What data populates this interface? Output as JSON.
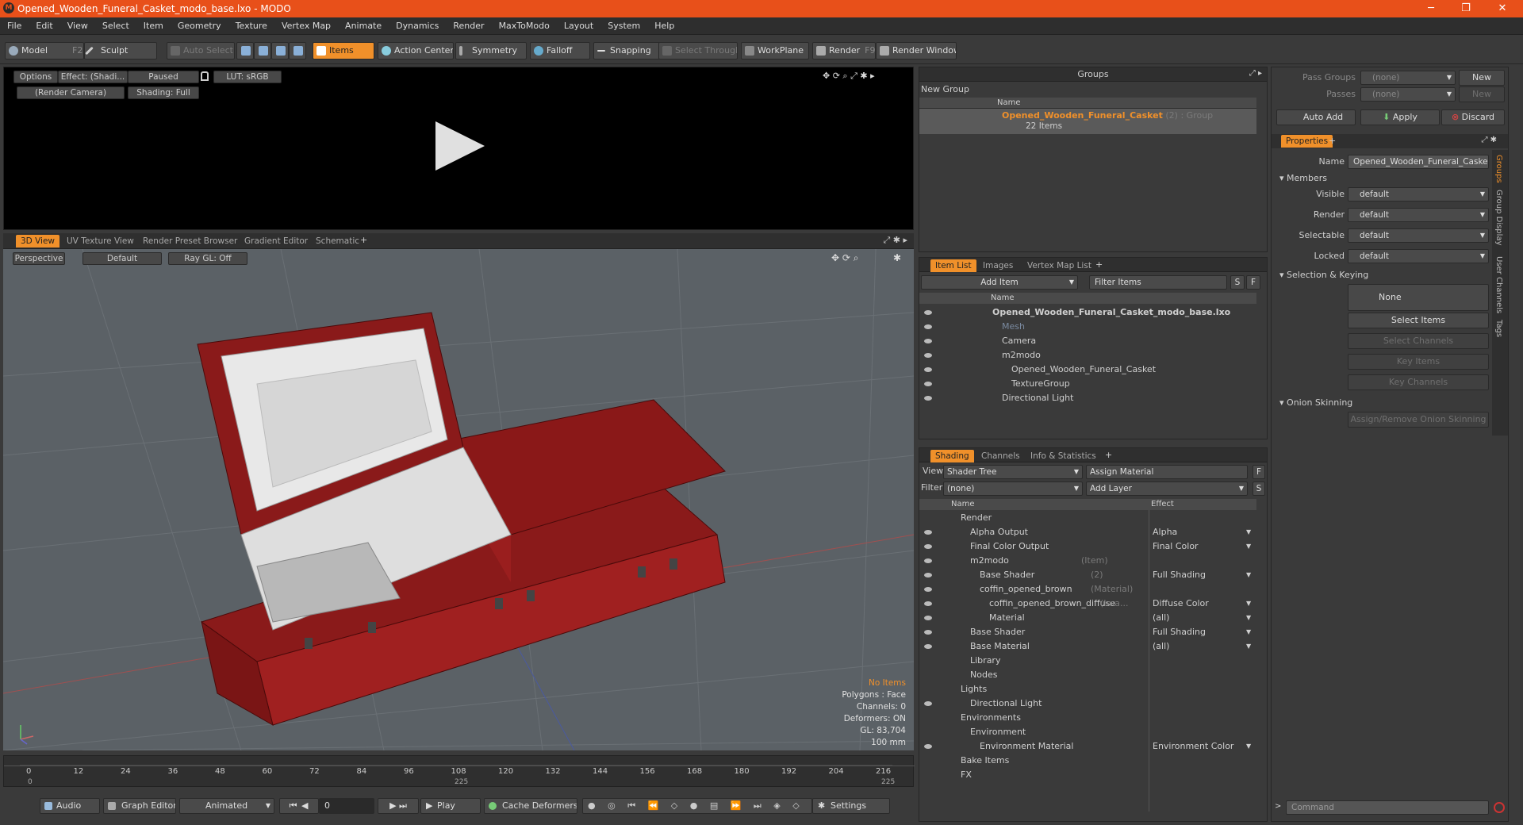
{
  "window": {
    "title": "Opened_Wooden_Funeral_Casket_modo_base.lxo - MODO",
    "logo": "modo-logo-icon",
    "accent": "#e8501a"
  },
  "menu": [
    "File",
    "Edit",
    "View",
    "Select",
    "Item",
    "Geometry",
    "Texture",
    "Vertex Map",
    "Animate",
    "Dynamics",
    "Render",
    "MaxToModo",
    "Layout",
    "System",
    "Help"
  ],
  "toolbar": {
    "model": "Model",
    "model_key": "F2",
    "sculpt": "Sculpt",
    "auto_select": "Auto Select",
    "items": "Items",
    "action_center": "Action Center",
    "symmetry": "Symmetry",
    "falloff": "Falloff",
    "snapping": "Snapping",
    "select_through": "Select Through",
    "workplane": "WorkPlane",
    "render": "Render",
    "render_key": "F9",
    "render_window": "Render Window"
  },
  "preview": {
    "options": "Options",
    "effect": "Effect: (Shadi...",
    "paused": "Paused",
    "lut": "LUT: sRGB",
    "camera": "(Render Camera)",
    "shading": "Shading: Full"
  },
  "viewport_tabs": [
    "3D View",
    "UV Texture View",
    "Render Preset Browser",
    "Gradient Editor",
    "Schematic"
  ],
  "viewport": {
    "perspective": "Perspective",
    "default": "Default",
    "raygl": "Ray GL: Off",
    "stats": {
      "no_items": "No Items",
      "polygons": "Polygons : Face",
      "channels": "Channels: 0",
      "deformers": "Deformers: ON",
      "gl": "GL: 83,704",
      "size": "100 mm"
    }
  },
  "timeline": {
    "ticks": [
      "0",
      "12",
      "24",
      "36",
      "48",
      "60",
      "72",
      "84",
      "96",
      "108",
      "120",
      "132",
      "144",
      "156",
      "168",
      "180",
      "192",
      "204",
      "216"
    ],
    "sub_left": "0",
    "sub_mid": "225",
    "sub_right": "225"
  },
  "bottombar": {
    "audio": "Audio",
    "graph_editor": "Graph Editor",
    "animated": "Animated",
    "frame": "0",
    "play": "Play",
    "cache": "Cache Deformers",
    "settings": "Settings"
  },
  "groups": {
    "title": "Groups",
    "new_group": "New Group",
    "col_name": "Name",
    "item_name": "Opened_Wooden_Funeral_Casket",
    "item_count": "(2)",
    "item_type": ": Group",
    "item_sub": "22 Items"
  },
  "itemlist": {
    "tabs": [
      "Item List",
      "Images",
      "Vertex Map List"
    ],
    "add_item": "Add Item",
    "filter": "Filter Items",
    "s": "S",
    "f": "F",
    "col_name": "Name",
    "rows": [
      {
        "label": "Opened_Wooden_Funeral_Casket_modo_base.lxo",
        "indent": 0,
        "bold": true
      },
      {
        "label": "Mesh",
        "indent": 1,
        "dim": true
      },
      {
        "label": "Camera",
        "indent": 1
      },
      {
        "label": "m2modo",
        "indent": 1
      },
      {
        "label": "Opened_Wooden_Funeral_Casket",
        "indent": 2
      },
      {
        "label": "TextureGroup",
        "indent": 2
      },
      {
        "label": "Directional Light",
        "indent": 1
      }
    ]
  },
  "shading": {
    "tabs": [
      "Shading",
      "Channels",
      "Info & Statistics"
    ],
    "view_label": "View",
    "view_value": "Shader Tree",
    "assign_material": "Assign Material",
    "filter_label": "Filter",
    "filter_value": "(none)",
    "add_layer": "Add Layer",
    "f": "F",
    "s": "S",
    "col_name": "Name",
    "col_effect": "Effect",
    "rows": [
      {
        "name": "Render",
        "extra": "",
        "effect": "",
        "indent": 0
      },
      {
        "name": "Alpha Output",
        "extra": "",
        "effect": "Alpha",
        "indent": 1
      },
      {
        "name": "Final Color Output",
        "extra": "",
        "effect": "Final Color",
        "indent": 1
      },
      {
        "name": "m2modo",
        "extra": "(Item)",
        "effect": "",
        "indent": 1
      },
      {
        "name": "Base Shader",
        "extra": "(2)",
        "effect": "Full Shading",
        "indent": 2
      },
      {
        "name": "coffin_opened_brown",
        "extra": "(Material)",
        "effect": "",
        "indent": 2
      },
      {
        "name": "coffin_opened_brown_diffuse",
        "extra": "(Ima...",
        "effect": "Diffuse Color",
        "indent": 3
      },
      {
        "name": "Material",
        "extra": "",
        "effect": "(all)",
        "indent": 3
      },
      {
        "name": "Base Shader",
        "extra": "",
        "effect": "Full Shading",
        "indent": 1
      },
      {
        "name": "Base Material",
        "extra": "",
        "effect": "(all)",
        "indent": 1
      },
      {
        "name": "Library",
        "extra": "",
        "effect": "",
        "indent": 1
      },
      {
        "name": "Nodes",
        "extra": "",
        "effect": "",
        "indent": 1
      },
      {
        "name": "Lights",
        "extra": "",
        "effect": "",
        "indent": 0
      },
      {
        "name": "Directional Light",
        "extra": "",
        "effect": "",
        "indent": 1
      },
      {
        "name": "Environments",
        "extra": "",
        "effect": "",
        "indent": 0
      },
      {
        "name": "Environment",
        "extra": "",
        "effect": "",
        "indent": 1
      },
      {
        "name": "Environment Material",
        "extra": "",
        "effect": "Environment Color",
        "indent": 2
      },
      {
        "name": "Bake Items",
        "extra": "",
        "effect": "",
        "indent": 0
      },
      {
        "name": "FX",
        "extra": "",
        "effect": "",
        "indent": 0
      }
    ]
  },
  "props": {
    "pass_groups": "Pass Groups",
    "passes": "Passes",
    "none": "(none)",
    "new": "New",
    "auto_add": "Auto Add",
    "apply": "Apply",
    "discard": "Discard",
    "properties_tab": "Properties",
    "name_label": "Name",
    "name_value": "Opened_Wooden_Funeral_Casket",
    "members": "Members",
    "visible": "Visible",
    "render": "Render",
    "selectable": "Selectable",
    "locked": "Locked",
    "default": "default",
    "selection_keying": "Selection & Keying",
    "sel_none": "None",
    "select_items": "Select Items",
    "select_channels": "Select Channels",
    "key_items": "Key Items",
    "key_channels": "Key Channels",
    "onion": "Onion Skinning",
    "assign_onion": "Assign/Remove Onion Skinning",
    "side_tabs": [
      "Groups",
      "Group Display",
      "User Channels",
      "Tags"
    ],
    "command": "Command"
  }
}
